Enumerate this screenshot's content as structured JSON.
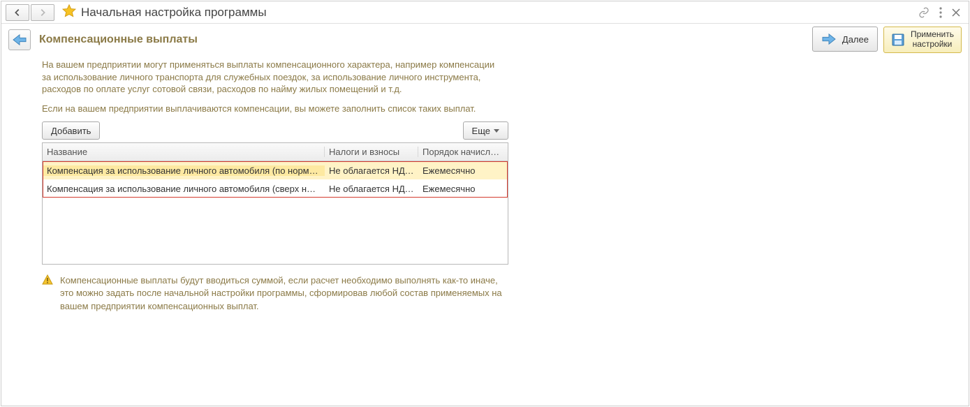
{
  "title": "Начальная настройка программы",
  "section_title": "Компенсационные выплаты",
  "buttons": {
    "next": "Далее",
    "apply_line1": "Применить",
    "apply_line2": "настройки",
    "add": "Добавить",
    "more": "Еще"
  },
  "paragraph1": "На вашем предприятии могут применяться выплаты компенсационного характера, например компенсации за использование личного транспорта для служебных поездок, за использование личного инструмента, расходов по оплате услуг сотовой связи, расходов по найму жилых помещений и т.д.",
  "paragraph2": "Если на вашем предприятии выплачиваются компенсации, вы можете заполнить список таких выплат.",
  "table": {
    "headers": {
      "name": "Название",
      "tax": "Налоги и взносы",
      "order": "Порядок начисле…"
    },
    "rows": [
      {
        "name": "Компенсация за использование личного автомобиля (по нормам)",
        "tax": "Не облагается НДФ…",
        "order": "Ежемесячно"
      },
      {
        "name": "Компенсация за использование личного автомобиля (сверх норм).",
        "tax": "Не облагается НДФ…",
        "order": "Ежемесячно"
      }
    ]
  },
  "warning": "Компенсационные выплаты будут вводиться суммой, если расчет необходимо выполнять как-то иначе, это можно задать после начальной настройки программы, сформировав любой состав применяемых на вашем предприятии компенсационных выплат."
}
